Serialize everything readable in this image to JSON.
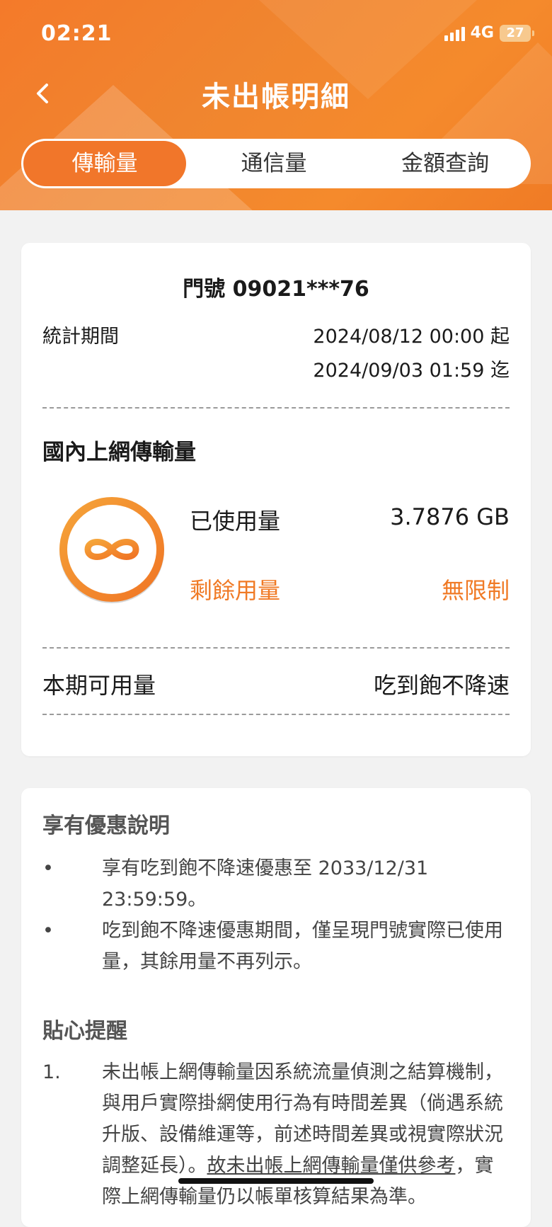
{
  "status_bar": {
    "time": "02:21",
    "network": "4G",
    "battery": "27"
  },
  "header": {
    "title": "未出帳明細",
    "back_icon": "chevron-left-icon"
  },
  "tabs": [
    {
      "label": "傳輸量",
      "active": true
    },
    {
      "label": "通信量",
      "active": false
    },
    {
      "label": "金額查詢",
      "active": false
    }
  ],
  "usage_card": {
    "phone": "門號 09021***76",
    "period_label": "統計期間",
    "period_start": "2024/08/12 00:00 起",
    "period_end": "2024/09/03 01:59 迄",
    "section_title": "國內上網傳輸量",
    "used_label": "已使用量",
    "used_value": "3.7876 GB",
    "remaining_label": "剩餘用量",
    "remaining_value": "無限制",
    "available_label": "本期可用量",
    "available_value": "吃到飽不降速",
    "ring_icon": "infinity-icon"
  },
  "offer_card": {
    "title": "享有優惠說明",
    "bullets": [
      {
        "line1": "享有吃到飽不降速優惠至 2033/12/31",
        "line2": "23:59:59。"
      },
      {
        "line1": "吃到飽不降速優惠期間，僅呈現門號實際已使用",
        "line2": "量，其餘用量不再列示。"
      }
    ],
    "reminder_title": "貼心提醒",
    "reminder_number": "1.",
    "reminder_lines": [
      "未出帳上網傳輸量因系統流量偵測之結算機制，",
      "與用戶實際掛網使用行為有時間差異（倘遇系統",
      "升版、設備維運等，前述時間差異或視實際狀況",
      "調整延長）。故未出帳上網傳輸量僅供參考，實",
      "際上網傳輸量仍以帳單核算結果為準。"
    ],
    "reminder_underlined": "故未出帳上網傳輸量僅供參考"
  },
  "colors": {
    "accent": "#f1762a",
    "accent_text": "#f07a25",
    "background": "#f2f2f2"
  }
}
